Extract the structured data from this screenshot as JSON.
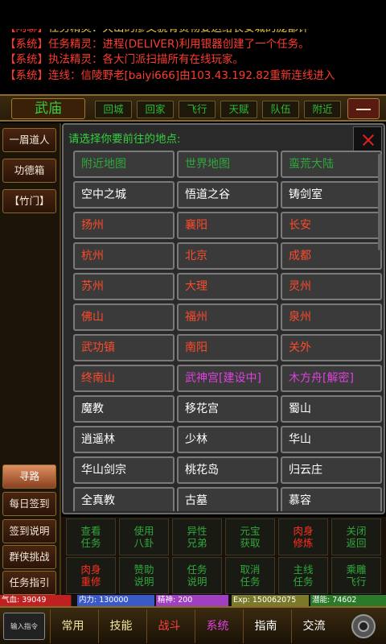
{
  "chat": [
    {
      "tag": "【闲聊】",
      "label": "任务精灵",
      "msg": "天山的廖文骁有货物要送给长安城的庞都钟"
    },
    {
      "tag": "【系统】",
      "label": "任务精灵",
      "msg": "进程(DELIVER)利用银器创建了一个任务。"
    },
    {
      "tag": "【系统】",
      "label": "执法精灵",
      "msg": "各大门派扫描所有在线玩家。"
    },
    {
      "tag": "【系统】",
      "label": "连线",
      "msg": "信陵野老[baiyi666]由103.43.192.82重新连线进入"
    }
  ],
  "location": {
    "name": "武庙",
    "buttons": [
      "回城",
      "回家",
      "飞行",
      "天赋",
      "队伍",
      "附近"
    ]
  },
  "sidebar": {
    "top": [
      "一眉道人",
      "功德箱",
      "【竹门】"
    ],
    "bottom": [
      "寻路",
      "每日签到",
      "签到说明",
      "群侠挑战",
      "任务指引"
    ]
  },
  "panel": {
    "title": "请选择你要前往的地点:",
    "cells": [
      {
        "text": "附近地图",
        "color": "#2fa83a"
      },
      {
        "text": "世界地图",
        "color": "#2fa83a"
      },
      {
        "text": "蛮荒大陆",
        "color": "#2fa83a"
      },
      {
        "text": "空中之城",
        "color": "#ffffff"
      },
      {
        "text": "悟道之谷",
        "color": "#ffffff"
      },
      {
        "text": "铸剑室",
        "color": "#ffffff"
      },
      {
        "text": "扬州",
        "color": "#ff4a2a"
      },
      {
        "text": "襄阳",
        "color": "#ff4a2a"
      },
      {
        "text": "长安",
        "color": "#ff4a2a"
      },
      {
        "text": "杭州",
        "color": "#ff4a2a"
      },
      {
        "text": "北京",
        "color": "#ff4a2a"
      },
      {
        "text": "成都",
        "color": "#ff4a2a"
      },
      {
        "text": "苏州",
        "color": "#ff4a2a"
      },
      {
        "text": "大理",
        "color": "#ff4a2a"
      },
      {
        "text": "灵州",
        "color": "#ff4a2a"
      },
      {
        "text": "佛山",
        "color": "#ff4a2a"
      },
      {
        "text": "福州",
        "color": "#ff4a2a"
      },
      {
        "text": "泉州",
        "color": "#ff4a2a"
      },
      {
        "text": "武功镇",
        "color": "#ff4a2a"
      },
      {
        "text": "南阳",
        "color": "#ff4a2a"
      },
      {
        "text": "关外",
        "color": "#ff4a2a"
      },
      {
        "text": "终南山",
        "color": "#ff4a2a"
      },
      {
        "text": "武神宫[建设中]",
        "color": "#e040e0"
      },
      {
        "text": "木方舟[解密]",
        "color": "#e040e0"
      },
      {
        "text": "魔教",
        "color": "#ffffff"
      },
      {
        "text": "移花宫",
        "color": "#ffffff"
      },
      {
        "text": "蜀山",
        "color": "#ffffff"
      },
      {
        "text": "逍遥林",
        "color": "#ffffff"
      },
      {
        "text": "少林",
        "color": "#ffffff"
      },
      {
        "text": "华山",
        "color": "#ffffff"
      },
      {
        "text": "华山剑宗",
        "color": "#ffffff"
      },
      {
        "text": "桃花岛",
        "color": "#ffffff"
      },
      {
        "text": "归云庄",
        "color": "#ffffff"
      },
      {
        "text": "全真教",
        "color": "#ffffff"
      },
      {
        "text": "古墓",
        "color": "#ffffff"
      },
      {
        "text": "慕容",
        "color": "#ffffff"
      }
    ]
  },
  "actions": [
    {
      "l1": "查看",
      "l2": "任务",
      "color": "#2fa83a"
    },
    {
      "l1": "使用",
      "l2": "八卦",
      "color": "#2fa83a"
    },
    {
      "l1": "异性",
      "l2": "兄弟",
      "color": "#2fa83a"
    },
    {
      "l1": "元宝",
      "l2": "获取",
      "color": "#2fa83a"
    },
    {
      "l1": "肉身",
      "l2": "修炼",
      "color": "#ff3020"
    },
    {
      "l1": "关闭",
      "l2": "返回",
      "color": "#2fa83a"
    },
    {
      "l1": "肉身",
      "l2": "重修",
      "color": "#ff3020"
    },
    {
      "l1": "赞助",
      "l2": "说明",
      "color": "#2fa83a"
    },
    {
      "l1": "任务",
      "l2": "说明",
      "color": "#2fa83a"
    },
    {
      "l1": "取消",
      "l2": "任务",
      "color": "#2fa83a"
    },
    {
      "l1": "主线",
      "l2": "任务",
      "color": "#2fa83a"
    },
    {
      "l1": "乘雕",
      "l2": "飞行",
      "color": "#2fa83a"
    }
  ],
  "stats": {
    "qixue": "气血: 39049",
    "neili": "内力: 130000",
    "jingshen": "精神: 200",
    "exp": "Exp: 150062075",
    "qianneng": "潜能: 74602"
  },
  "tabs": {
    "input": "输入指令",
    "items": [
      {
        "label": "常用",
        "color": "#f0e8a0"
      },
      {
        "label": "技能",
        "color": "#f0e8a0"
      },
      {
        "label": "战斗",
        "color": "#ff4040"
      },
      {
        "label": "系统",
        "color": "#e040e0"
      },
      {
        "label": "指南",
        "color": "#ffffff"
      },
      {
        "label": "交流",
        "color": "#ffffff"
      }
    ],
    "settings": "gear-icon"
  }
}
